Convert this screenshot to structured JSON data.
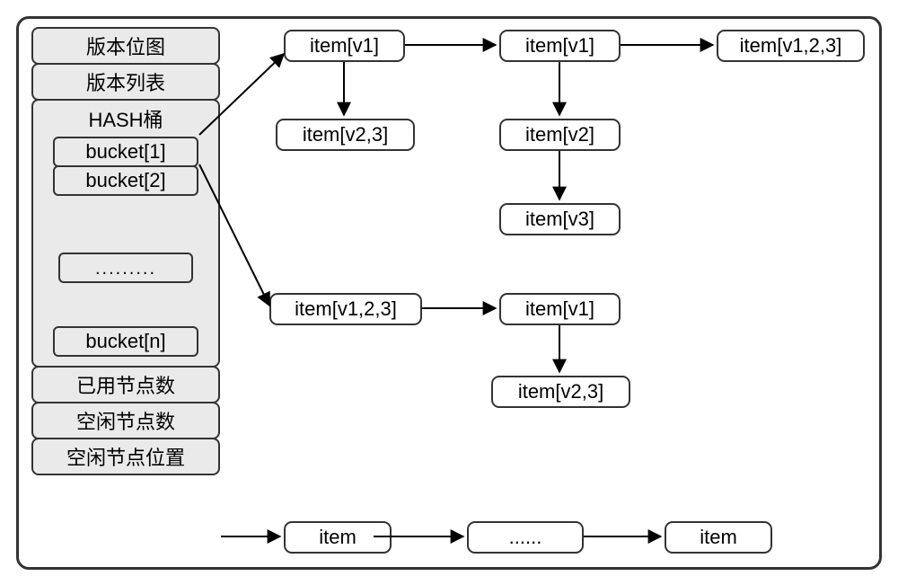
{
  "sidebar": {
    "bitmap": "版本位图",
    "verlist": "版本列表",
    "hash_title": "HASH桶",
    "buckets": [
      "bucket[1]",
      "bucket[2]",
      "bucket[n]"
    ],
    "bucket_ellipsis": ".........",
    "used_nodes": "已用节点数",
    "free_nodes": "空闲节点数",
    "free_node_pos": "空闲节点位置"
  },
  "graph": {
    "r1c1": "item[v1]",
    "r1c2": "item[v1]",
    "r1c3": "item[v1,2,3]",
    "r2c1": "item[v2,3]",
    "r2c2": "item[v2]",
    "r3c2": "item[v3]",
    "r4c1": "item[v1,2,3]",
    "r4c2": "item[v1]",
    "r5c2": "item[v2,3]",
    "free1": "item",
    "free_dots": "......",
    "free2": "item"
  }
}
